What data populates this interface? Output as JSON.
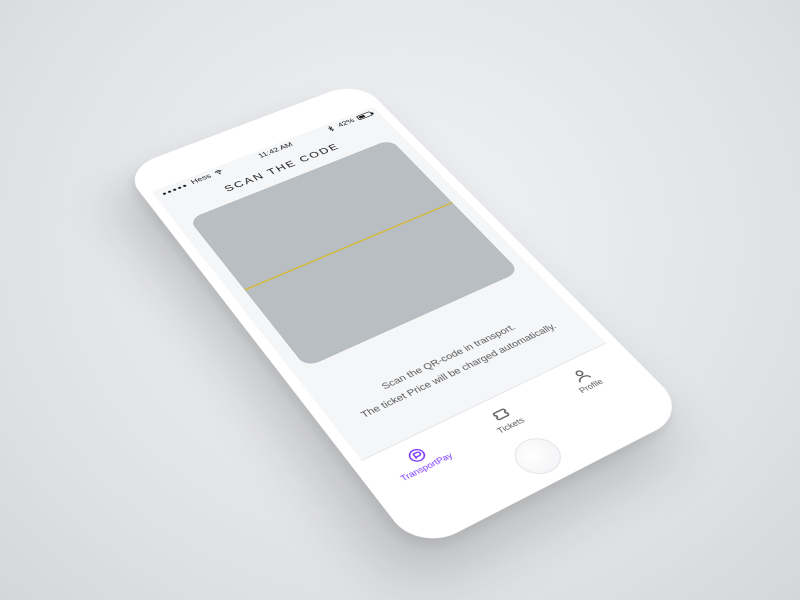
{
  "status_bar": {
    "carrier": "Hess",
    "time": "11:42 AM",
    "battery_percent": "42%"
  },
  "screen": {
    "title": "SCAN THE CODE",
    "hint_line1": "Scan the QR-code in transport.",
    "hint_line2": "The ticket Price will be charged automatically."
  },
  "tabs": [
    {
      "id": "transportpay",
      "label": "TransportPay",
      "active": true
    },
    {
      "id": "tickets",
      "label": "Tickets",
      "active": false
    },
    {
      "id": "profile",
      "label": "Profile",
      "active": false
    }
  ],
  "colors": {
    "accent": "#7a36ff",
    "scanline": "#d4b93a",
    "viewport": "#b9bec2"
  }
}
